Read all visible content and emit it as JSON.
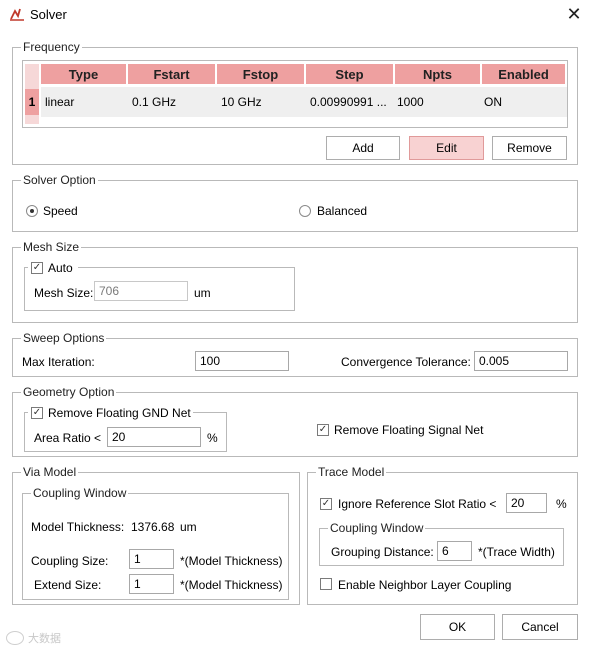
{
  "window": {
    "title": "Solver",
    "icon": "solver-icon",
    "close_icon": "close-icon"
  },
  "frequency": {
    "title": "Frequency",
    "columns": [
      "Type",
      "Fstart",
      "Fstop",
      "Step",
      "Npts",
      "Enabled"
    ],
    "rows": [
      {
        "index": "1",
        "cells": [
          "linear",
          "0.1 GHz",
          "10 GHz",
          "0.00990991 ...",
          "1000",
          "ON"
        ]
      }
    ],
    "buttons": {
      "add": "Add",
      "edit": "Edit",
      "remove": "Remove"
    }
  },
  "solver_option": {
    "title": "Solver Option",
    "speed_label": "Speed",
    "balanced_label": "Balanced",
    "selected": "Speed"
  },
  "mesh_size": {
    "title": "Mesh Size",
    "auto_label": "Auto",
    "auto_checked": true,
    "mesh_size_label": "Mesh Size:",
    "mesh_size_value": "706",
    "unit": "um"
  },
  "sweep_options": {
    "title": "Sweep Options",
    "max_iteration_label": "Max Iteration:",
    "max_iteration_value": "100",
    "convergence_label": "Convergence Tolerance:",
    "convergence_value": "0.005"
  },
  "geometry_option": {
    "title": "Geometry Option",
    "remove_gnd_label": "Remove Floating GND Net",
    "remove_gnd_checked": true,
    "area_ratio_label": "Area Ratio <",
    "area_ratio_value": "20",
    "area_ratio_unit": "%",
    "remove_signal_label": "Remove Floating Signal Net",
    "remove_signal_checked": true
  },
  "via_model": {
    "title": "Via Model",
    "coupling_window_title": "Coupling Window",
    "model_thickness_label": "Model Thickness:",
    "model_thickness_value": "1376.68",
    "model_thickness_unit": "um",
    "coupling_size_label": "Coupling Size:",
    "coupling_size_value": "1",
    "coupling_size_unit": "*(Model Thickness)",
    "extend_size_label": "Extend Size:",
    "extend_size_value": "1",
    "extend_size_unit": "*(Model Thickness)"
  },
  "trace_model": {
    "title": "Trace Model",
    "ignore_ref_label": "Ignore Reference Slot Ratio <",
    "ignore_ref_checked": true,
    "ignore_ref_value": "20",
    "ignore_ref_unit": "%",
    "coupling_window_title": "Coupling Window",
    "grouping_distance_label": "Grouping Distance:",
    "grouping_distance_value": "6",
    "grouping_distance_unit": "*(Trace Width)",
    "neighbor_label": "Enable Neighbor Layer Coupling",
    "neighbor_checked": false
  },
  "footer": {
    "ok": "OK",
    "cancel": "Cancel",
    "watermark": "大数据"
  },
  "colors": {
    "header": "#eea0a0",
    "active_button": "#f8d2d2",
    "row_bg": "#efefef"
  }
}
